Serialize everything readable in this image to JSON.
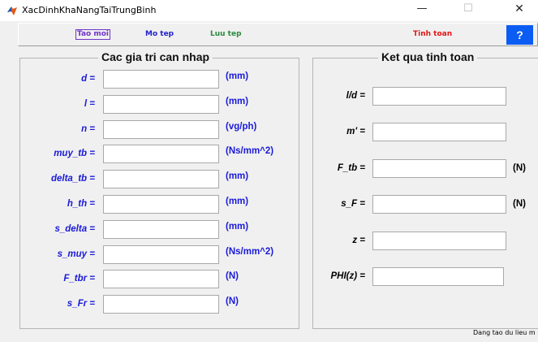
{
  "window": {
    "title": "XacDinhKhaNangTaiTrungBinh",
    "minimize_glyph": "—",
    "maximize_glyph": "☐",
    "close_glyph": "✕",
    "icon": "matlab-icon"
  },
  "toolbar": {
    "tao_moi": "Tao moi",
    "mo_tep": "Mo tep",
    "luu_tep": "Luu tep",
    "tinh_toan": "Tinh toan",
    "help": "?",
    "colors": {
      "tao_moi": "#6f35c9",
      "mo_tep": "#2222cc",
      "luu_tep": "#2b8a3e",
      "tinh_toan": "#e01818",
      "help_bg": "#0b5cf2"
    }
  },
  "input_panel": {
    "title": "Cac gia tri can nhap",
    "rows": [
      {
        "label": "d =",
        "value": "",
        "unit": "(mm)"
      },
      {
        "label": "l =",
        "value": "",
        "unit": "(mm)"
      },
      {
        "label": "n =",
        "value": "",
        "unit": "(vg/ph)"
      },
      {
        "label": "muy_tb =",
        "value": "",
        "unit": "(Ns/mm^2)"
      },
      {
        "label": "delta_tb =",
        "value": "",
        "unit": "(mm)"
      },
      {
        "label": "h_th =",
        "value": "",
        "unit": "(mm)"
      },
      {
        "label": "s_delta =",
        "value": "",
        "unit": "(mm)"
      },
      {
        "label": "s_muy =",
        "value": "",
        "unit": "(Ns/mm^2)"
      },
      {
        "label": "F_tbr =",
        "value": "",
        "unit": "(N)"
      },
      {
        "label": "s_Fr =",
        "value": "",
        "unit": "(N)"
      }
    ]
  },
  "result_panel": {
    "title": "Ket qua tinh toan",
    "rows": [
      {
        "label": "l/d =",
        "value": "",
        "unit": ""
      },
      {
        "label": "m' =",
        "value": "",
        "unit": ""
      },
      {
        "label": "F_tb =",
        "value": "",
        "unit": "(N)"
      },
      {
        "label": "s_F =",
        "value": "",
        "unit": "(N)"
      },
      {
        "label": "z =",
        "value": "",
        "unit": ""
      },
      {
        "label": "PHI(z) =",
        "value": "",
        "unit": ""
      }
    ]
  },
  "status": {
    "text": "Dang tao du lieu m"
  }
}
